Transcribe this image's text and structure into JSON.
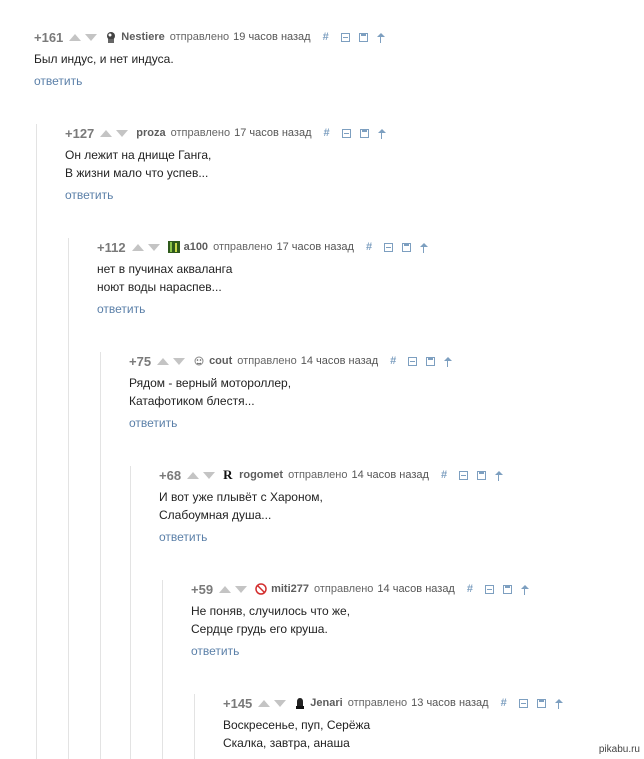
{
  "comments": [
    {
      "rating": "+161",
      "username": "Nestiere",
      "sent": "отправлено",
      "time": "19 часов назад",
      "lines": [
        "Был индус, и нет индуса."
      ],
      "reply": "ответить"
    },
    {
      "rating": "+127",
      "username": "proza",
      "sent": "отправлено",
      "time": "17 часов назад",
      "lines": [
        "Он лежит на днище Ганга,",
        "В жизни мало что успев..."
      ],
      "reply": "ответить"
    },
    {
      "rating": "+112",
      "username": "a100",
      "sent": "отправлено",
      "time": "17 часов назад",
      "lines": [
        "нет в пучинах акваланга",
        "ноют воды нараспев..."
      ],
      "reply": "ответить"
    },
    {
      "rating": "+75",
      "username": "cout",
      "sent": "отправлено",
      "time": "14 часов назад",
      "lines": [
        "Рядом - верный мотороллер,",
        "Катафотиком блестя..."
      ],
      "reply": "ответить"
    },
    {
      "rating": "+68",
      "username": "rogomet",
      "sent": "отправлено",
      "time": "14 часов назад",
      "lines": [
        "И вот уже плывёт с Хароном,",
        "Слабоумная душа..."
      ],
      "reply": "ответить"
    },
    {
      "rating": "+59",
      "username": "miti277",
      "sent": "отправлено",
      "time": "14 часов назад",
      "lines": [
        "Не поняв, случилось что же,",
        "Сердце грудь его круша."
      ],
      "reply": "ответить"
    },
    {
      "rating": "+145",
      "username": "Jenari",
      "sent": "отправлено",
      "time": "13 часов назад",
      "lines": [
        "Воскресенье, пуп, Серёжа",
        "Скалка, завтра, анаша"
      ],
      "reply": ""
    }
  ],
  "tools": {
    "hash": "#"
  },
  "avatar_rogomet": "R",
  "watermark": "pikabu.ru"
}
